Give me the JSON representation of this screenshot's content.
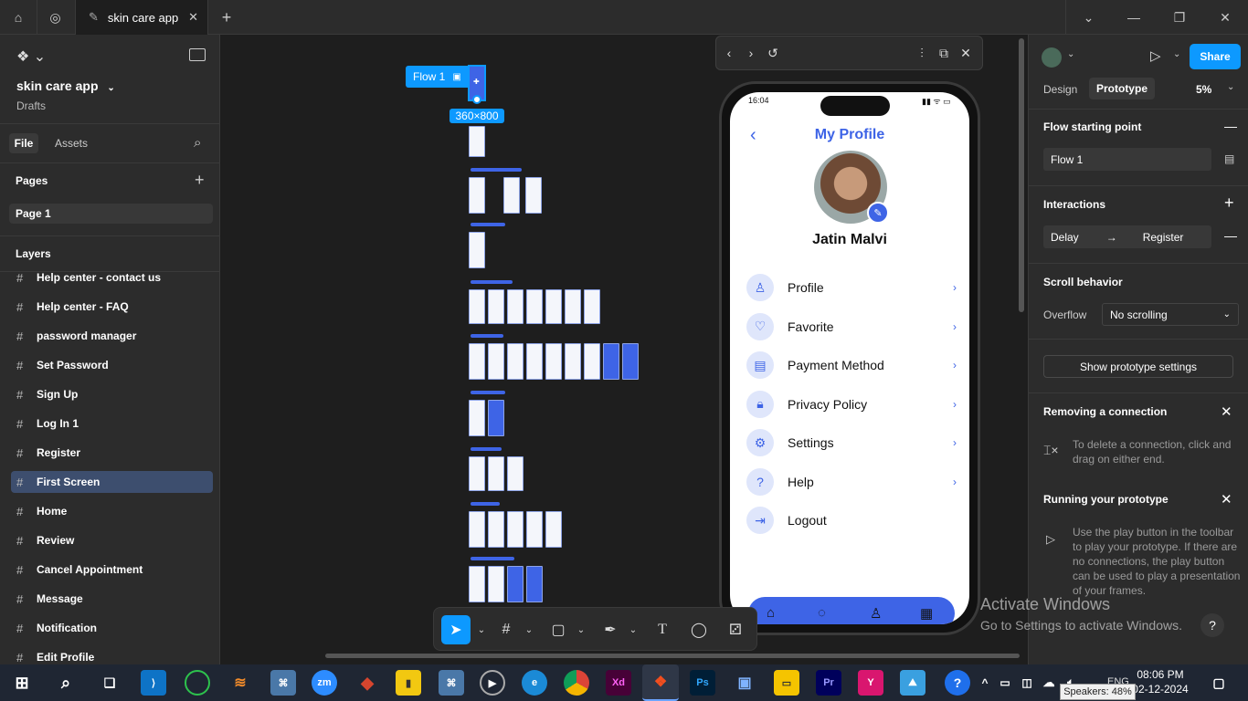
{
  "titlebar": {
    "tab_title": "skin care app"
  },
  "left_panel": {
    "project_name": "skin care app",
    "project_location": "Drafts",
    "tabs": [
      "File",
      "Assets"
    ],
    "pages_header": "Pages",
    "pages": [
      "Page 1"
    ],
    "layers_header": "Layers",
    "layers": [
      "Help center - contact us",
      "Help center - FAQ",
      "password manager",
      "Set Password",
      "Sign Up",
      "Log In 1",
      "Register",
      "First Screen",
      "Home",
      "Review",
      "Cancel Appointment",
      "Message",
      "Notification",
      "Edit Profile"
    ],
    "selected_layer": "First Screen"
  },
  "canvas": {
    "flow_label": "Flow 1",
    "size_label": "360×800"
  },
  "prototype_preview": {
    "status_time": "16:04",
    "screen_title": "My Profile",
    "user_name": "Jatin Malvi",
    "menu_items": [
      {
        "label": "Profile",
        "icon": "user-icon"
      },
      {
        "label": "Favorite",
        "icon": "heart-icon"
      },
      {
        "label": "Payment Method",
        "icon": "wallet-icon"
      },
      {
        "label": "Privacy Policy",
        "icon": "lock-icon"
      },
      {
        "label": "Settings",
        "icon": "gear-icon"
      },
      {
        "label": "Help",
        "icon": "question-icon"
      },
      {
        "label": "Logout",
        "icon": "logout-icon"
      }
    ],
    "accent_color": "#3e64e6"
  },
  "right_panel": {
    "share_label": "Share",
    "tabs": [
      "Design",
      "Prototype"
    ],
    "active_tab": "Prototype",
    "zoom": "5%",
    "flow_starting_point_header": "Flow starting point",
    "flow_name": "Flow 1",
    "interactions_header": "Interactions",
    "interaction_trigger": "Delay",
    "interaction_target": "Register",
    "scroll_behavior_header": "Scroll behavior",
    "overflow_label": "Overflow",
    "overflow_value": "No scrolling",
    "show_prototype_settings": "Show prototype settings",
    "removing_connection_header": "Removing a connection",
    "removing_connection_text": "To delete a connection, click and drag on either end.",
    "running_prototype_header": "Running your prototype",
    "running_prototype_text": "Use the play button in the toolbar to play your prototype. If there are no connections, the play button can be used to play a presentation of your frames."
  },
  "watermark": {
    "line1": "Activate Windows",
    "line2": "Go to Settings to activate Windows."
  },
  "taskbar": {
    "time": "08:06 PM",
    "date": "02-12-2024",
    "language": "ENG",
    "speaker_tooltip": "Speakers: 48%"
  }
}
